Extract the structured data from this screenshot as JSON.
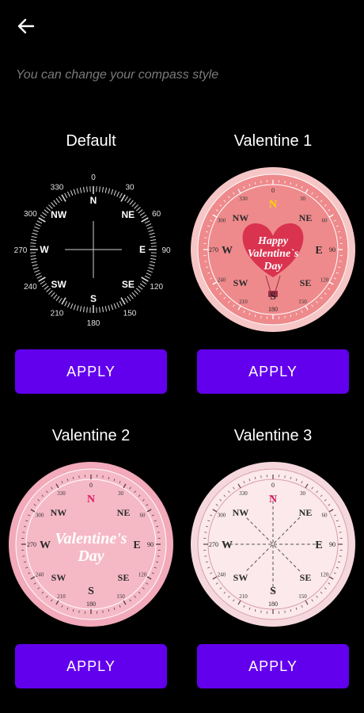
{
  "header": {
    "subtitle": "You can change your compass style"
  },
  "styles": [
    {
      "title": "Default",
      "apply_label": "APPLY"
    },
    {
      "title": "Valentine 1",
      "apply_label": "APPLY",
      "center_text": [
        "Happy",
        "Valentine`s",
        "Day"
      ]
    },
    {
      "title": "Valentine 2",
      "apply_label": "APPLY",
      "center_text": [
        "Valentine's",
        "Day"
      ]
    },
    {
      "title": "Valentine 3",
      "apply_label": "APPLY"
    }
  ],
  "compass": {
    "degrees": [
      "0",
      "30",
      "60",
      "90",
      "120",
      "150",
      "180",
      "210",
      "240",
      "270",
      "300",
      "330"
    ],
    "directions": [
      "N",
      "NE",
      "E",
      "SE",
      "S",
      "SW",
      "W",
      "NW"
    ]
  },
  "colors": {
    "accent": "#6200ee",
    "background": "#000000",
    "subtitle": "#7a7a7a"
  }
}
